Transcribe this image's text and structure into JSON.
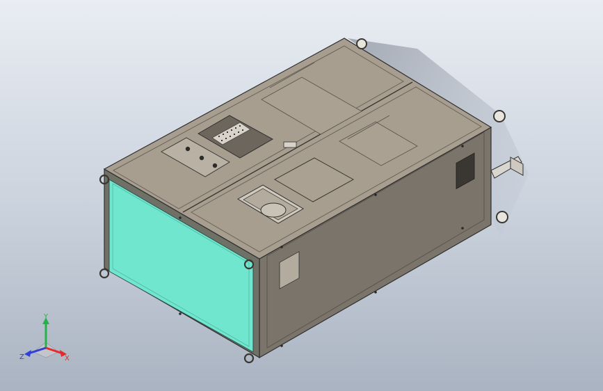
{
  "triad": {
    "x_label": "X",
    "y_label": "Y",
    "z_label": "Z",
    "x_color": "#e32b2b",
    "y_color": "#24b24a",
    "z_color": "#2f3fd8"
  },
  "model": {
    "front_panel_color": "#71e6cf",
    "body_color": "#a79e90",
    "side_color": "#7b746b",
    "outline_color": "#2f2f2f"
  }
}
